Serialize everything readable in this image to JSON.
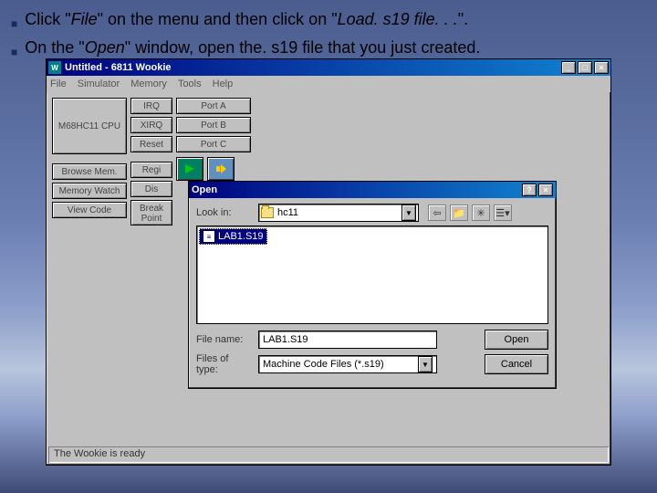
{
  "instructions": {
    "line1_a": "Click \"",
    "line1_b": "File",
    "line1_c": "\" on the menu and then click on \"",
    "line1_d": "Load. s19 file. . .",
    "line1_e": "\".",
    "line2_a": "On the \"",
    "line2_b": "Open",
    "line2_c": "\" window, open the. s19 file that you just created."
  },
  "app": {
    "title": "Untitled - 6811 Wookie",
    "menu": [
      "File",
      "Simulator",
      "Memory",
      "Tools",
      "Help"
    ],
    "buttons": {
      "cpu": "M68HC11 CPU",
      "browse": "Browse Mem.",
      "memwatch": "Memory Watch",
      "viewcode": "View Code",
      "irq": "IRQ",
      "xirq": "XIRQ",
      "reset": "Reset",
      "regi": "Regi",
      "dis": "Dis",
      "break": "Break\nPoint",
      "porta": "Port A",
      "portb": "Port B",
      "portc": "Port C"
    },
    "status": "The Wookie is ready"
  },
  "dialog": {
    "title": "Open",
    "lookin_label": "Look in:",
    "lookin_value": "hc11",
    "file_selected": "LAB1.S19",
    "filename_label": "File name:",
    "filename_value": "LAB1.S19",
    "filetype_label": "Files of type:",
    "filetype_value": "Machine Code Files (*.s19)",
    "open_btn": "Open",
    "cancel_btn": "Cancel"
  }
}
